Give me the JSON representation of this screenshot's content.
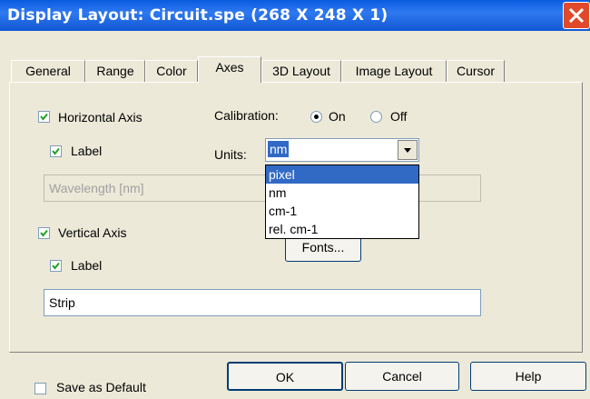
{
  "window": {
    "title": "Display Layout: Circuit.spe (268 X 248 X 1)"
  },
  "tabs": [
    {
      "label": "General"
    },
    {
      "label": "Range"
    },
    {
      "label": "Color"
    },
    {
      "label": "Axes"
    },
    {
      "label": "3D Layout"
    },
    {
      "label": "Image Layout"
    },
    {
      "label": "Cursor"
    }
  ],
  "active_tab": "Axes",
  "horizontal_axis": {
    "label": "Horizontal Axis",
    "checked": true,
    "label_checkbox": "Label",
    "label_checked": true,
    "label_text": "Wavelength [nm]"
  },
  "calibration": {
    "label": "Calibration:",
    "on": "On",
    "off": "Off",
    "selected": "On"
  },
  "units": {
    "label": "Units:",
    "value": "nm",
    "options": [
      "pixel",
      "nm",
      "cm-1",
      "rel. cm-1"
    ],
    "highlighted": "pixel"
  },
  "vertical_axis": {
    "label": "Vertical Axis",
    "checked": true,
    "label_checkbox": "Label",
    "label_checked": true,
    "label_text": "Strip"
  },
  "fonts_button": "Fonts...",
  "save_default": {
    "label": "Save as Default",
    "checked": false
  },
  "buttons": {
    "ok": "OK",
    "cancel": "Cancel",
    "help": "Help"
  },
  "colors": {
    "title_bar": "#0A5BE0",
    "dialog_bg": "#ECE9D8",
    "selection": "#316AC5",
    "close_button": "#E04A2A"
  }
}
